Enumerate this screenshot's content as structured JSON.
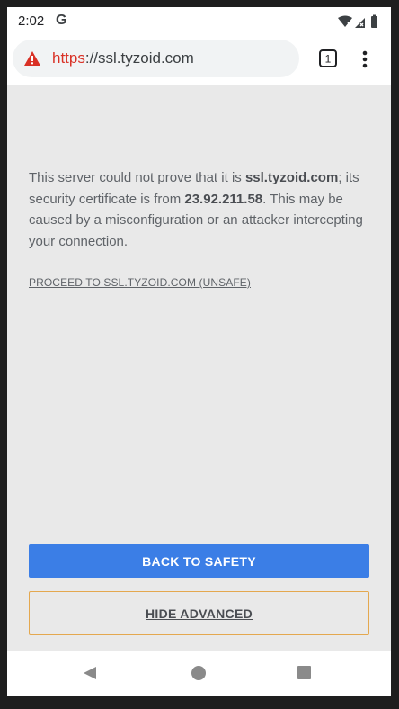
{
  "status_bar": {
    "time": "2:02",
    "google_glyph": "G",
    "icons": [
      "google-icon",
      "wifi-icon",
      "signal-icon",
      "battery-icon"
    ]
  },
  "toolbar": {
    "url_scheme": "https",
    "url_rest": "://ssl.tyzoid.com",
    "security_icon": "warning-icon",
    "tab_count": "1",
    "menu_icon": "more-vert-icon"
  },
  "message": {
    "part1": "This server could not prove that it is ",
    "domain": "ssl.tyzoid.com",
    "part2": "; its security certificate is from ",
    "issuer": "23.92.211.58",
    "part3": ". This may be caused by a misconfiguration or an attacker intercepting your connection."
  },
  "proceed_link": "PROCEED TO SSL.TYZOID.COM (UNSAFE)",
  "buttons": {
    "back_to_safety": "BACK TO SAFETY",
    "hide_advanced": "HIDE ADVANCED"
  },
  "nav_bar": {
    "icons": [
      "back-icon",
      "home-icon",
      "recents-icon"
    ]
  },
  "colors": {
    "primary_button": "#3b7ee6",
    "warning": "#d93025",
    "secondary_border": "#e4a84f",
    "content_bg": "#e9e9e9"
  }
}
